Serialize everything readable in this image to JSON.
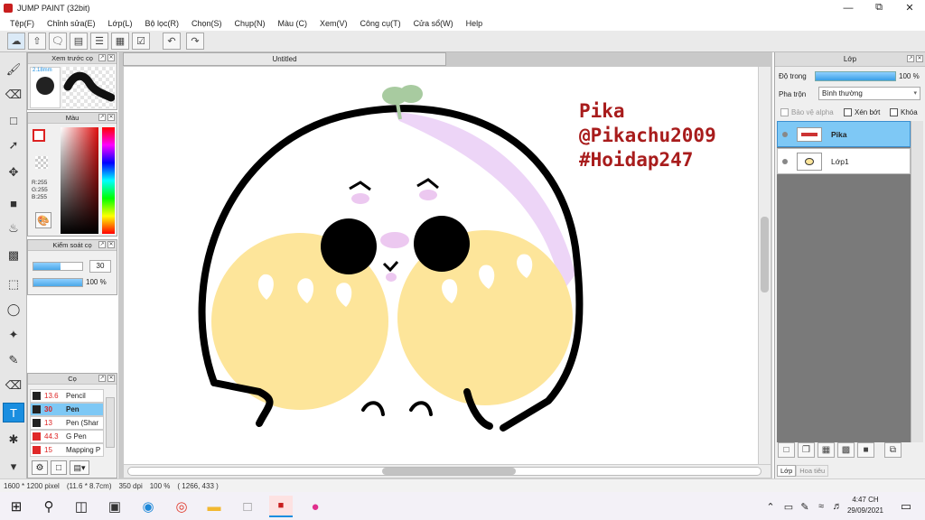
{
  "window": {
    "title": "JUMP PAINT (32bit)"
  },
  "menu": [
    "Tệp(F)",
    "Chỉnh sửa(E)",
    "Lớp(L)",
    "Bộ lọc(R)",
    "Chọn(S)",
    "Chụp(N)",
    "Màu (C)",
    "Xem(V)",
    "Công cụ(T)",
    "Cửa sổ(W)",
    "Help"
  ],
  "document": {
    "tab_title": "Untitled"
  },
  "brush_preview": {
    "title": "Xem trước cọ",
    "size": "2.18mm"
  },
  "color_panel": {
    "title": "Màu",
    "r": "R:255",
    "g": "G:255",
    "b": "B:255"
  },
  "brush_control": {
    "title": "Kiểm soát cọ",
    "size_value": "30",
    "opacity_value": "100 %",
    "size_fill": 0.55,
    "opacity_fill": 1.0
  },
  "brush_list": {
    "title": "Cọ",
    "items": [
      {
        "size": "13.6",
        "name": "Pencil",
        "color": "#222222",
        "selected": false
      },
      {
        "size": "30",
        "name": "Pen",
        "color": "#222222",
        "selected": true
      },
      {
        "size": "13",
        "name": "Pen (Shar",
        "color": "#222222",
        "selected": false
      },
      {
        "size": "44.3",
        "name": "G Pen",
        "color": "#e02828",
        "selected": false
      },
      {
        "size": "15",
        "name": "Mapping P",
        "color": "#e02828",
        "selected": false
      }
    ]
  },
  "layer_panel": {
    "title": "Lớp",
    "opacity_label": "Độ trong",
    "opacity_value": "100 %",
    "blend_label": "Pha trộn",
    "blend_value": "Bình thường",
    "protect_alpha": "Bảo vệ alpha",
    "clip": "Xén bớt",
    "lock": "Khóa",
    "layers": [
      {
        "name": "Pika",
        "selected": true
      },
      {
        "name": "Lớp1",
        "selected": false
      }
    ],
    "tabs": [
      "Lớp",
      "Hoa tiêu"
    ]
  },
  "artwork": {
    "text_lines": [
      "Pika",
      "@Pikachu2009",
      "#Hoidap247"
    ],
    "text_color": "#a81c1c"
  },
  "status": {
    "size": "1600 * 1200 pixel",
    "physical": "(11.6 * 8.7cm)",
    "dpi": "350 dpi",
    "zoom": "100 %",
    "coords": "( 1266, 433 )"
  },
  "taskbar": {
    "time": "4:47 CH",
    "date": "29/09/2021"
  },
  "colors": {
    "accent": "#1a8ee0",
    "selection": "#7ec8f5"
  }
}
